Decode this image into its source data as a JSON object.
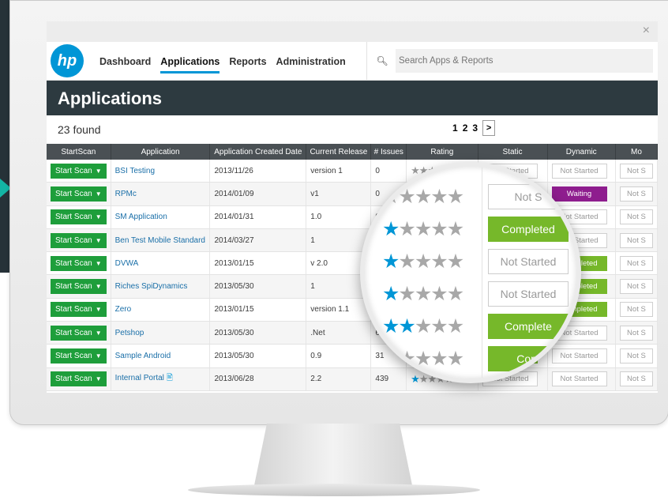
{
  "window": {
    "close_glyph": "×"
  },
  "logo": {
    "text": "hp"
  },
  "nav": {
    "items": [
      {
        "label": "Dashboard",
        "active": false
      },
      {
        "label": "Applications",
        "active": true
      },
      {
        "label": "Reports",
        "active": false
      },
      {
        "label": "Administration",
        "active": false
      }
    ]
  },
  "search": {
    "placeholder": "Search Apps & Reports",
    "icon": "search-icon"
  },
  "page": {
    "title": "Applications",
    "found": "23 found"
  },
  "pager": {
    "pages": [
      "1",
      "2",
      "3"
    ],
    "next": ">"
  },
  "table": {
    "headers": [
      "StartScan",
      "Application",
      "Application Created Date",
      "Current Release",
      "# Issues",
      "Rating",
      "Static",
      "Dynamic",
      "Mo"
    ],
    "start_scan_label": "Start Scan",
    "rows": [
      {
        "app": "BSI Testing",
        "date": "2013/11/26",
        "release": "version 1",
        "issues": "0",
        "rating": 0,
        "static": "Not Started",
        "dynamic": "Not Started",
        "mobile": "Not S"
      },
      {
        "app": "RPMc",
        "date": "2014/01/09",
        "release": "v1",
        "issues": "0",
        "rating": 0,
        "static": "Not Started",
        "dynamic": "Waiting",
        "mobile": "Not S"
      },
      {
        "app": "SM Application",
        "date": "2014/01/31",
        "release": "1.0",
        "issues": "0",
        "rating": 1,
        "static": "Completed",
        "dynamic": "Not Started",
        "mobile": "Not S"
      },
      {
        "app": "Ben Test Mobile Standard",
        "date": "2014/03/27",
        "release": "1",
        "issues": "",
        "rating": 1,
        "static": "Completed",
        "dynamic": "Not Started",
        "mobile": "Not S"
      },
      {
        "app": "DVWA",
        "date": "2013/01/15",
        "release": "v 2.0",
        "issues": "",
        "rating": 1,
        "static": "Not Started",
        "dynamic": "Completed",
        "mobile": "Not S"
      },
      {
        "app": "Riches SpiDynamics",
        "date": "2013/05/30",
        "release": "1",
        "issues": "",
        "rating": 1,
        "static": "Not Started",
        "dynamic": "Completed",
        "mobile": "Not S"
      },
      {
        "app": "Zero",
        "date": "2013/01/15",
        "release": "version 1.1",
        "issues": "2",
        "rating": 2,
        "static": "Completed",
        "dynamic": "Completed",
        "mobile": "Not S"
      },
      {
        "app": "Petshop",
        "date": "2013/05/30",
        "release": ".Net",
        "issues": "6",
        "rating": 2,
        "static": "Completed",
        "dynamic": "Not Started",
        "mobile": "Not S"
      },
      {
        "app": "Sample Android",
        "date": "2013/05/30",
        "release": "0.9",
        "issues": "31",
        "rating": 1,
        "static": "Completed",
        "dynamic": "Not Started",
        "mobile": "Not S"
      },
      {
        "app": "Internal Portal",
        "date": "2013/06/28",
        "release": "2.2",
        "issues": "439",
        "rating": 1,
        "static": "Not Started",
        "dynamic": "Not Started",
        "mobile": "Not S",
        "doc_icon": true
      }
    ]
  },
  "magnifier": {
    "rows": [
      {
        "rating": 0,
        "status": "Not S"
      },
      {
        "rating": 1,
        "status": "Completed"
      },
      {
        "rating": 1,
        "status": "Not Started"
      },
      {
        "rating": 1,
        "status": "Not Started"
      },
      {
        "rating": 2,
        "status": "Complete"
      },
      {
        "rating": 1,
        "status": "Com"
      }
    ]
  },
  "colors": {
    "brand": "#0096d6",
    "header_dark": "#2d3a40",
    "start_scan_green": "#1e9e3b",
    "completed_green": "#76b82a",
    "waiting_purple": "#8e1d8e"
  }
}
